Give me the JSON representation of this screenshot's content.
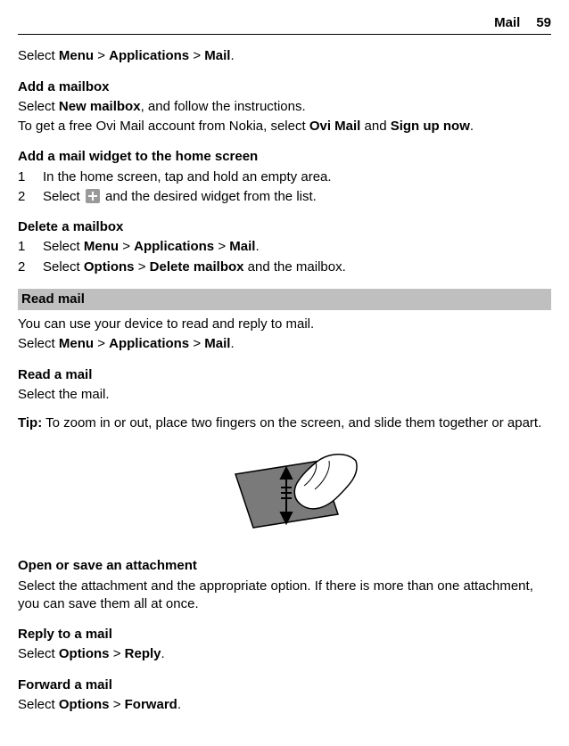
{
  "header": {
    "title": "Mail",
    "page_number": "59"
  },
  "intro": {
    "t1": "Select ",
    "menu": "Menu",
    "sep1": " > ",
    "apps": "Applications",
    "sep2": " > ",
    "mail": "Mail",
    "t2": "."
  },
  "add_mailbox": {
    "heading": "Add a mailbox",
    "l1a": "Select ",
    "l1b": "New mailbox",
    "l1c": ", and follow the instructions.",
    "l2a": "To get a free Ovi Mail account from Nokia, select ",
    "l2b": "Ovi Mail",
    "l2c": " and ",
    "l2d": "Sign up now",
    "l2e": "."
  },
  "add_widget": {
    "heading": "Add a mail widget to the home screen",
    "step1_num": "1",
    "step1_text": "In the home screen, tap and hold an empty area.",
    "step2_num": "2",
    "step2_a": "Select ",
    "step2_b": " and the desired widget from the list."
  },
  "delete_mailbox": {
    "heading": "Delete a mailbox",
    "step1_num": "1",
    "s1a": "Select ",
    "s1_menu": "Menu",
    "s1_sep1": " > ",
    "s1_apps": "Applications",
    "s1_sep2": " > ",
    "s1_mail": "Mail",
    "s1_end": ".",
    "step2_num": "2",
    "s2a": "Select ",
    "s2_options": "Options",
    "s2_sep": " > ",
    "s2_delete": "Delete mailbox",
    "s2_end": " and the mailbox."
  },
  "read_mail_bar": "Read mail",
  "read_mail_intro": "You can use your device to read and reply to mail.",
  "read_mail_path": {
    "a": "Select ",
    "menu": "Menu",
    "sep1": " > ",
    "apps": "Applications",
    "sep2": " > ",
    "mail": "Mail",
    "end": "."
  },
  "read_a_mail": {
    "heading": "Read a mail",
    "body": "Select the mail."
  },
  "tip": {
    "label": "Tip:",
    "body": " To zoom in or out, place two fingers on the screen, and slide them together or apart."
  },
  "attachment": {
    "heading": "Open or save an attachment",
    "body": "Select the attachment and the appropriate option. If there is more than one attachment, you can save them all at once."
  },
  "reply": {
    "heading": "Reply to a mail",
    "a": "Select ",
    "options": "Options",
    "sep": " > ",
    "reply": "Reply",
    "end": "."
  },
  "forward": {
    "heading": "Forward a mail",
    "a": "Select ",
    "options": "Options",
    "sep": " > ",
    "forward": "Forward",
    "end": "."
  }
}
